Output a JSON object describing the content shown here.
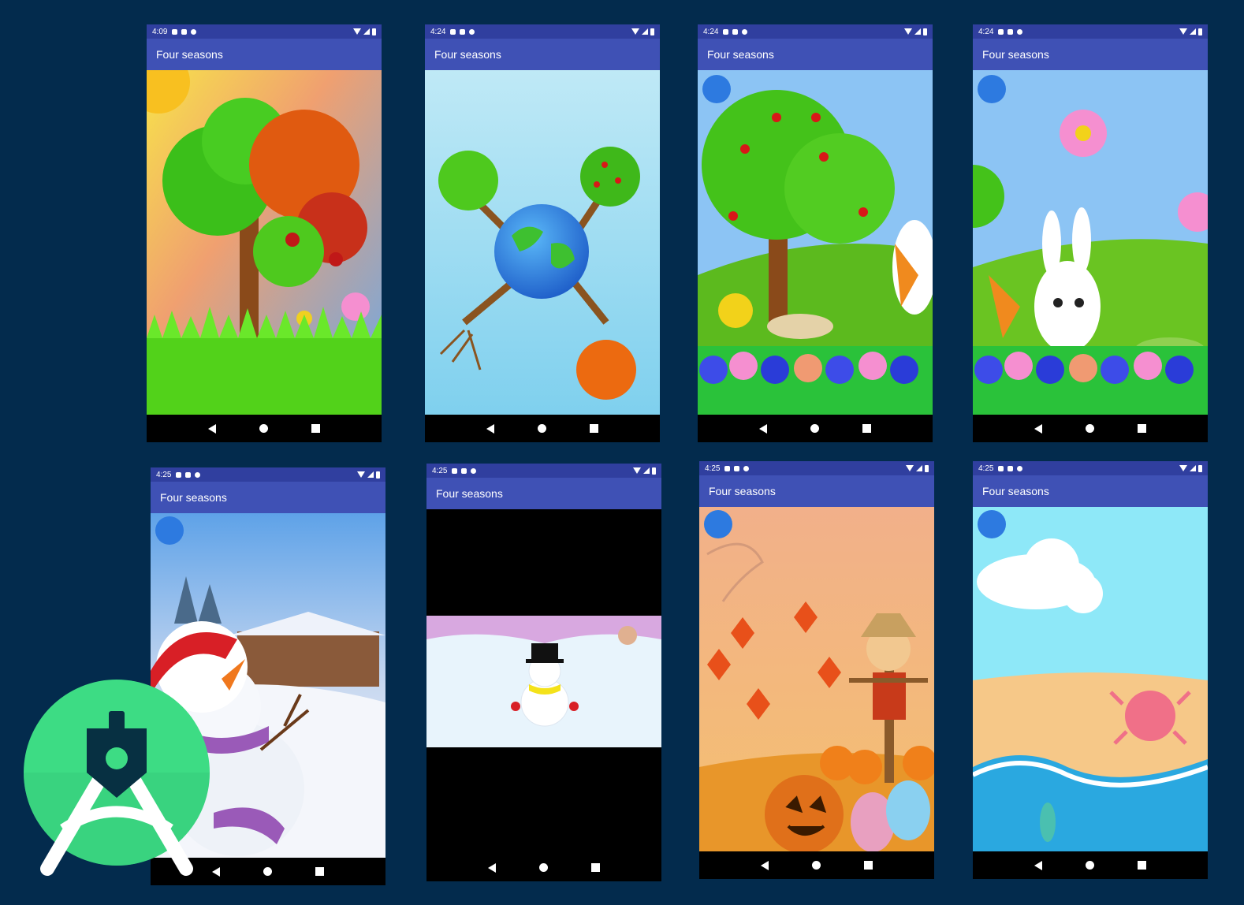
{
  "app_title": "Four seasons",
  "screens": [
    {
      "time": "4:09",
      "title": "Four seasons"
    },
    {
      "time": "4:24",
      "title": "Four seasons"
    },
    {
      "time": "4:24",
      "title": "Four seasons"
    },
    {
      "time": "4:24",
      "title": "Four seasons"
    },
    {
      "time": "4:25",
      "title": "Four seasons"
    },
    {
      "time": "4:25",
      "title": "Four seasons"
    },
    {
      "time": "4:25",
      "title": "Four seasons"
    },
    {
      "time": "4:25",
      "title": "Four seasons"
    }
  ],
  "colors": {
    "background": "#032b4d",
    "status_bar": "#303f9f",
    "app_bar": "#3f51b5",
    "android_green": "#3ddc84"
  },
  "icons": [
    "shield-icon",
    "sim-icon",
    "sync-icon",
    "wifi-icon",
    "signal-icon",
    "battery-icon",
    "back-icon",
    "home-icon",
    "recents-icon",
    "globe-icon",
    "android-studio-logo"
  ]
}
